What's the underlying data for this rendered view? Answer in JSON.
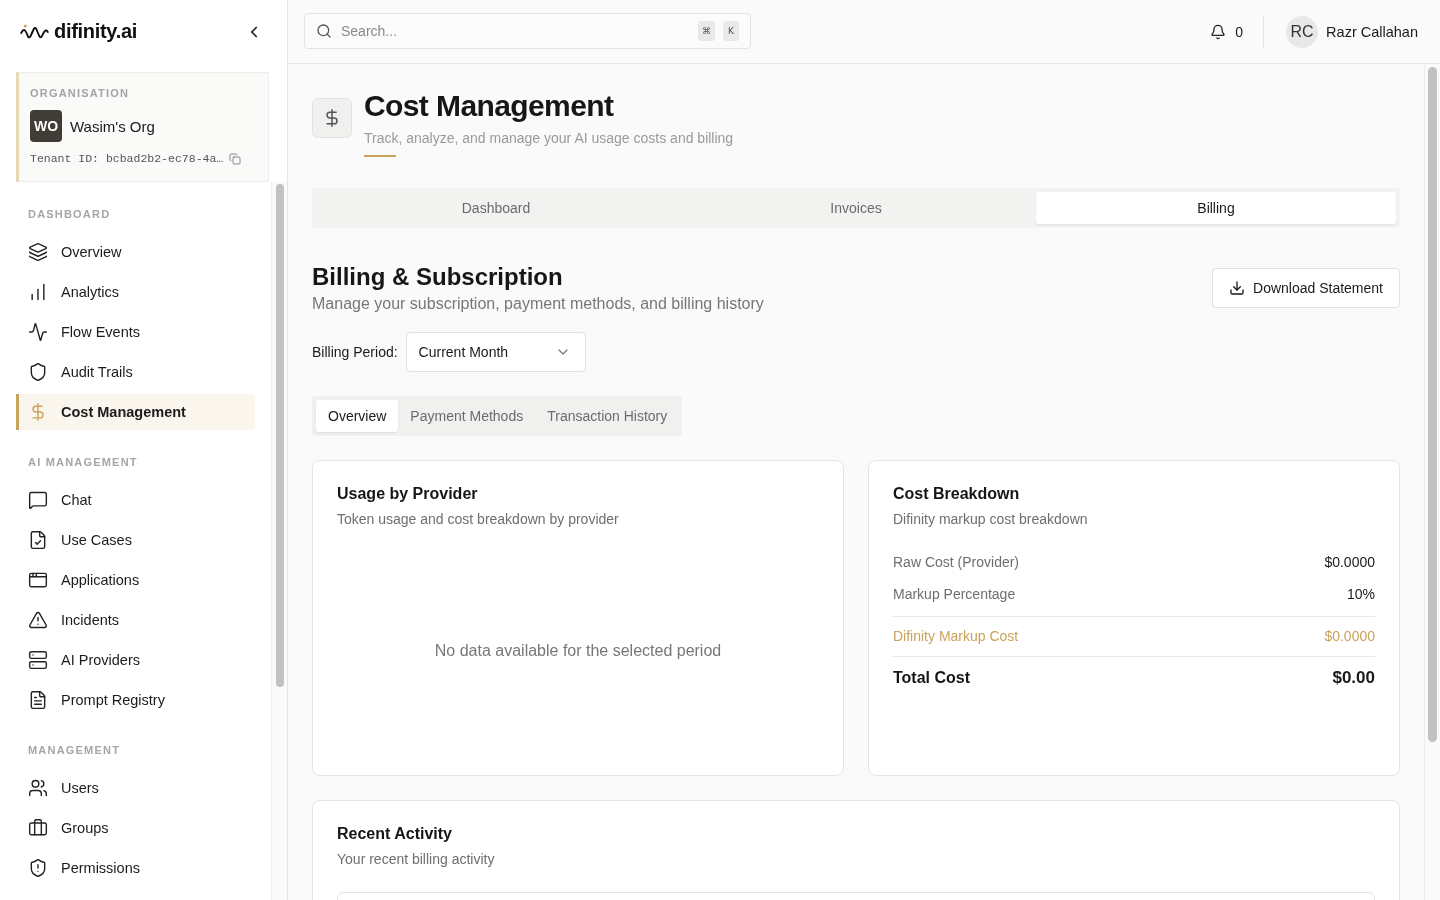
{
  "sidebar": {
    "logo": "difinity.ai",
    "organisation": {
      "label": "ORGANISATION",
      "initials": "WO",
      "name": "Wasim's Org",
      "tenant_id": "Tenant ID: bcbad2b2-ec78-4a…"
    },
    "sections": [
      {
        "title": "DASHBOARD",
        "items": [
          {
            "label": "Overview",
            "selected": false
          },
          {
            "label": "Analytics",
            "selected": false
          },
          {
            "label": "Flow Events",
            "selected": false
          },
          {
            "label": "Audit Trails",
            "selected": false
          },
          {
            "label": "Cost Management",
            "selected": true
          }
        ]
      },
      {
        "title": "AI MANAGEMENT",
        "items": [
          {
            "label": "Chat",
            "selected": false
          },
          {
            "label": "Use Cases",
            "selected": false
          },
          {
            "label": "Applications",
            "selected": false
          },
          {
            "label": "Incidents",
            "selected": false
          },
          {
            "label": "AI Providers",
            "selected": false
          },
          {
            "label": "Prompt Registry",
            "selected": false
          }
        ]
      },
      {
        "title": "MANAGEMENT",
        "items": [
          {
            "label": "Users",
            "selected": false
          },
          {
            "label": "Groups",
            "selected": false
          },
          {
            "label": "Permissions",
            "selected": false
          }
        ]
      }
    ]
  },
  "header": {
    "search": {
      "placeholder": "Search...",
      "shortcut": [
        "⌘",
        "K"
      ]
    },
    "notifications": "0",
    "user": {
      "initials": "RC",
      "name": "Razr Callahan"
    }
  },
  "page": {
    "title": "Cost Management",
    "subtitle": "Track, analyze, and manage your AI usage costs and billing",
    "tabs": [
      {
        "label": "Dashboard",
        "selected": false
      },
      {
        "label": "Invoices",
        "selected": false
      },
      {
        "label": "Billing",
        "selected": true
      }
    ],
    "billing": {
      "title": "Billing & Subscription",
      "subtitle": "Manage your subscription, payment methods, and billing history",
      "download_button": "Download Statement",
      "period": {
        "label": "Billing Period:",
        "value": "Current Month"
      },
      "tabs": [
        {
          "label": "Overview",
          "selected": true
        },
        {
          "label": "Payment Methods",
          "selected": false
        },
        {
          "label": "Transaction History",
          "selected": false
        }
      ],
      "usage_card": {
        "title": "Usage by Provider",
        "subtitle": "Token usage and cost breakdown by provider",
        "empty_message": "No data available for the selected period"
      },
      "cost_card": {
        "title": "Cost Breakdown",
        "subtitle": "Difinity markup cost breakdown",
        "rows": [
          {
            "kind": "plain",
            "label": "Raw Cost (Provider)",
            "value": "$0.0000"
          },
          {
            "kind": "plain",
            "label": "Markup Percentage",
            "value": "10%"
          },
          {
            "kind": "markup",
            "label": "Difinity Markup Cost",
            "value": "$0.0000"
          },
          {
            "kind": "total",
            "label": "Total Cost",
            "value": "$0.00"
          }
        ]
      },
      "activity_card": {
        "title": "Recent Activity",
        "subtitle": "Your recent billing activity"
      }
    }
  }
}
